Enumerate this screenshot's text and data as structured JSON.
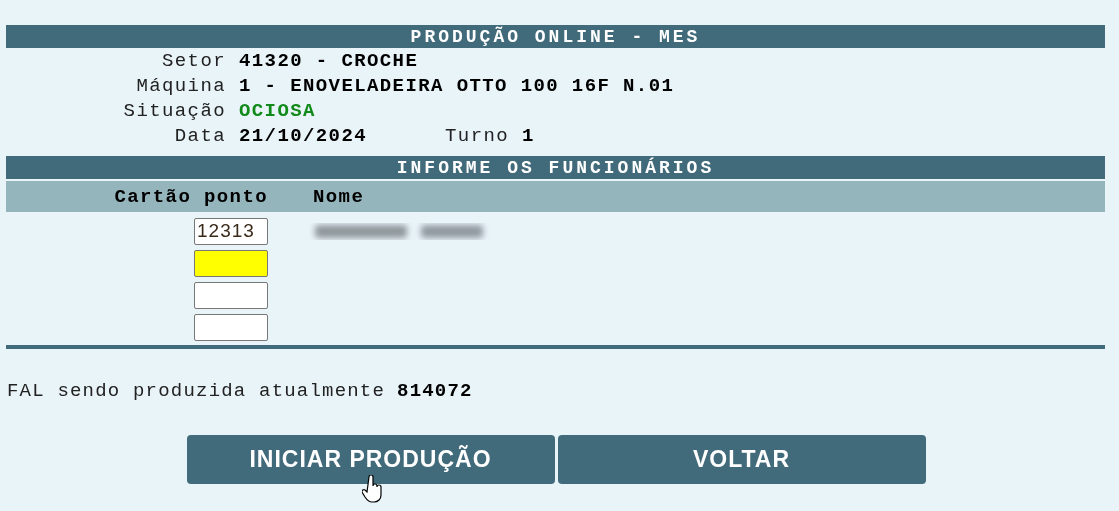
{
  "title": "PRODUÇÃO ONLINE - MES",
  "fields": [
    {
      "label": "Setor",
      "value": "41320 - CROCHE",
      "kind": "plain"
    },
    {
      "label": "Máquina",
      "value": "1 - ENOVELADEIRA OTTO 100 16F N.01",
      "kind": "plain"
    },
    {
      "label": "Situação",
      "value": "OCIOSA",
      "kind": "status"
    },
    {
      "label": "Data",
      "value": "21/10/2024",
      "kind": "plain",
      "extra": {
        "label": "Turno",
        "value": "1"
      }
    }
  ],
  "employees_section": {
    "title": "INFORME OS FUNCIONÁRIOS",
    "columns": [
      "Cartão ponto",
      "Nome"
    ],
    "rows": [
      {
        "card": "12313",
        "focused": false,
        "name_blurred": true
      },
      {
        "focused": true,
        "name_blurred": false
      },
      {
        "focused": false,
        "name_blurred": false
      },
      {
        "focused": false,
        "name_blurred": false
      }
    ]
  },
  "current": {
    "label": "FAL sendo produzida atualmente",
    "value": "814072"
  },
  "buttons": [
    "INICIAR PRODUÇÃO",
    "VOLTAR"
  ]
}
